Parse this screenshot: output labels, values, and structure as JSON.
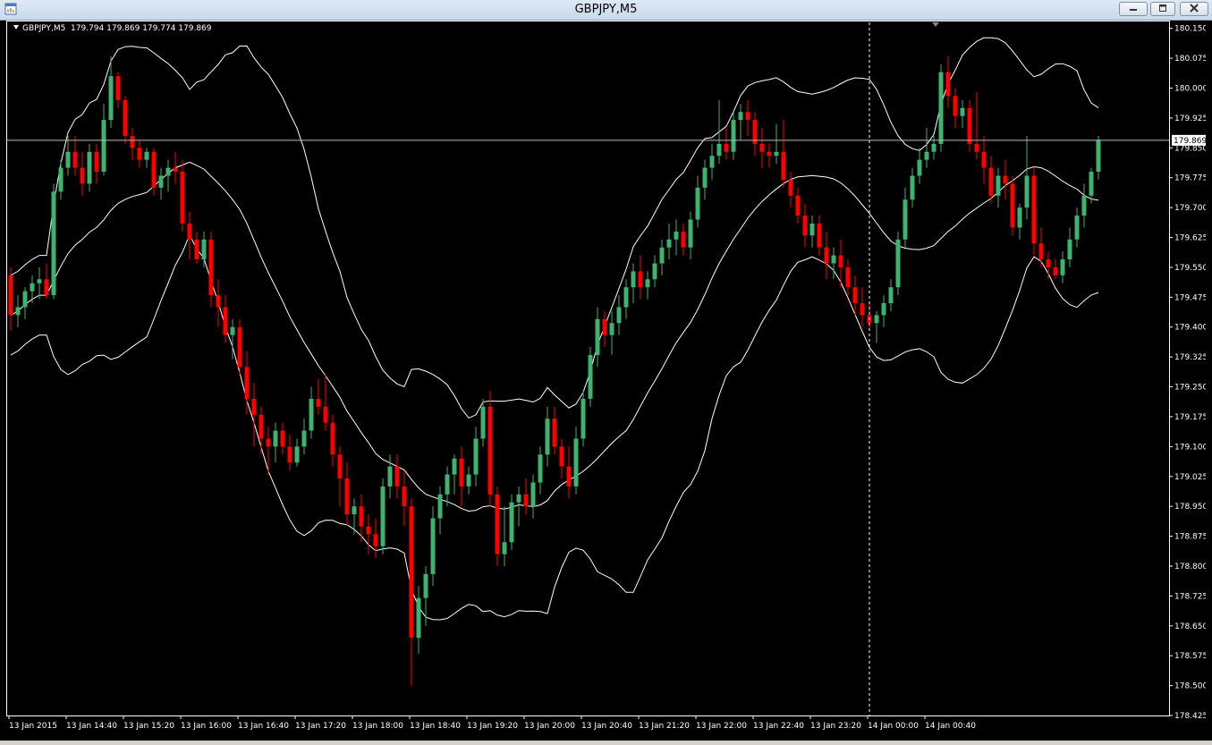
{
  "window": {
    "title": "GBPJPY,M5",
    "app_icon": "chart-window-icon",
    "buttons": {
      "minimize": "minimize-icon",
      "maximize": "maximize-icon",
      "close": "close-icon"
    }
  },
  "chart_header": {
    "symbol_tf": "GBPJPY,M5",
    "ohlc": "179.794 179.869 179.774 179.869"
  },
  "colors": {
    "bull": "#3cb371",
    "bear": "#ff0000",
    "bands": "#ffffff",
    "background": "#000000",
    "axis": "#ffffff"
  },
  "chart_data": {
    "type": "candlestick",
    "symbol": "GBPJPY",
    "timeframe": "M5",
    "indicator": "Bollinger Bands",
    "ylim": [
      178.425,
      180.165
    ],
    "y_ticks": [
      "180.150",
      "180.075",
      "180.000",
      "179.925",
      "179.850",
      "179.775",
      "179.700",
      "179.625",
      "179.550",
      "179.475",
      "179.400",
      "179.325",
      "179.250",
      "179.175",
      "179.100",
      "179.025",
      "178.950",
      "178.875",
      "178.800",
      "178.725",
      "178.650",
      "178.575",
      "178.500",
      "178.425"
    ],
    "x_ticks": [
      "13 Jan 2015",
      "13 Jan 14:40",
      "13 Jan 15:20",
      "13 Jan 16:00",
      "13 Jan 16:40",
      "13 Jan 17:20",
      "13 Jan 18:00",
      "13 Jan 18:40",
      "13 Jan 19:20",
      "13 Jan 20:00",
      "13 Jan 20:40",
      "13 Jan 21:20",
      "13 Jan 22:00",
      "13 Jan 22:40",
      "13 Jan 23:20",
      "14 Jan 00:00",
      "14 Jan 00:40"
    ],
    "current_price": "179.869",
    "candles": [
      [
        179.53,
        179.55,
        179.39,
        179.43
      ],
      [
        179.43,
        179.48,
        179.4,
        179.45
      ],
      [
        179.45,
        179.5,
        179.42,
        179.49
      ],
      [
        179.49,
        179.53,
        179.46,
        179.51
      ],
      [
        179.51,
        179.55,
        179.47,
        179.52
      ],
      [
        179.52,
        179.56,
        179.47,
        179.48
      ],
      [
        179.48,
        179.76,
        179.47,
        179.74
      ],
      [
        179.74,
        179.82,
        179.72,
        179.8
      ],
      [
        179.8,
        179.88,
        179.78,
        179.84
      ],
      [
        179.84,
        179.88,
        179.78,
        179.8
      ],
      [
        179.8,
        179.84,
        179.73,
        179.76
      ],
      [
        179.76,
        179.86,
        179.74,
        179.84
      ],
      [
        179.84,
        179.86,
        179.76,
        179.79
      ],
      [
        179.79,
        179.96,
        179.78,
        179.92
      ],
      [
        179.92,
        180.08,
        179.9,
        180.03
      ],
      [
        180.03,
        180.04,
        179.95,
        179.97
      ],
      [
        179.97,
        179.98,
        179.86,
        179.88
      ],
      [
        179.88,
        179.9,
        179.82,
        179.85
      ],
      [
        179.85,
        179.87,
        179.8,
        179.82
      ],
      [
        179.82,
        179.85,
        179.8,
        179.84
      ],
      [
        179.84,
        179.85,
        179.73,
        179.75
      ],
      [
        179.75,
        179.8,
        179.72,
        179.78
      ],
      [
        179.78,
        179.82,
        179.74,
        179.8
      ],
      [
        179.8,
        179.84,
        179.76,
        179.79
      ],
      [
        179.79,
        179.82,
        179.64,
        179.66
      ],
      [
        179.66,
        179.69,
        179.57,
        179.62
      ],
      [
        179.62,
        179.64,
        179.56,
        179.57
      ],
      [
        179.57,
        179.64,
        179.55,
        179.62
      ],
      [
        179.62,
        179.64,
        179.45,
        179.48
      ],
      [
        179.48,
        179.52,
        179.4,
        179.45
      ],
      [
        179.45,
        179.48,
        179.36,
        179.38
      ],
      [
        179.38,
        179.42,
        179.32,
        179.4
      ],
      [
        179.4,
        179.42,
        179.28,
        179.3
      ],
      [
        179.3,
        179.34,
        179.18,
        179.22
      ],
      [
        179.22,
        179.26,
        179.1,
        179.18
      ],
      [
        179.18,
        179.2,
        179.08,
        179.12
      ],
      [
        179.12,
        179.15,
        179.03,
        179.1
      ],
      [
        179.1,
        179.16,
        179.06,
        179.14
      ],
      [
        179.14,
        179.16,
        179.08,
        179.1
      ],
      [
        179.1,
        179.13,
        179.04,
        179.06
      ],
      [
        179.06,
        179.12,
        179.05,
        179.1
      ],
      [
        179.1,
        179.17,
        179.08,
        179.14
      ],
      [
        179.14,
        179.25,
        179.12,
        179.22
      ],
      [
        179.22,
        179.27,
        179.18,
        179.2
      ],
      [
        179.2,
        179.28,
        179.14,
        179.16
      ],
      [
        179.16,
        179.18,
        179.05,
        179.08
      ],
      [
        179.08,
        179.1,
        178.95,
        179.02
      ],
      [
        179.02,
        179.06,
        178.9,
        178.93
      ],
      [
        178.93,
        178.97,
        178.88,
        178.95
      ],
      [
        178.95,
        178.98,
        178.86,
        178.9
      ],
      [
        178.9,
        178.93,
        178.83,
        178.88
      ],
      [
        178.88,
        178.92,
        178.82,
        178.85
      ],
      [
        178.85,
        179.02,
        178.83,
        179.0
      ],
      [
        179.0,
        179.08,
        178.97,
        179.05
      ],
      [
        179.05,
        179.08,
        178.97,
        179.0
      ],
      [
        179.0,
        179.04,
        178.9,
        178.95
      ],
      [
        178.95,
        178.97,
        178.5,
        178.62
      ],
      [
        178.62,
        178.75,
        178.58,
        178.72
      ],
      [
        178.72,
        178.8,
        178.65,
        178.78
      ],
      [
        178.78,
        178.95,
        178.75,
        178.92
      ],
      [
        178.92,
        179.0,
        178.88,
        178.98
      ],
      [
        178.98,
        179.05,
        178.95,
        179.03
      ],
      [
        179.03,
        179.08,
        178.98,
        179.07
      ],
      [
        179.07,
        179.1,
        178.95,
        179.0
      ],
      [
        179.0,
        179.05,
        178.98,
        179.03
      ],
      [
        179.03,
        179.15,
        179.0,
        179.12
      ],
      [
        179.12,
        179.22,
        179.1,
        179.2
      ],
      [
        179.2,
        179.24,
        178.95,
        178.98
      ],
      [
        178.98,
        179.0,
        178.8,
        178.83
      ],
      [
        178.83,
        178.95,
        178.8,
        178.86
      ],
      [
        178.86,
        178.98,
        178.84,
        178.96
      ],
      [
        178.96,
        179.0,
        178.9,
        178.98
      ],
      [
        178.98,
        179.02,
        178.93,
        178.95
      ],
      [
        178.95,
        179.03,
        178.92,
        179.01
      ],
      [
        179.01,
        179.1,
        178.98,
        179.08
      ],
      [
        179.08,
        179.2,
        179.05,
        179.17
      ],
      [
        179.17,
        179.2,
        179.08,
        179.1
      ],
      [
        179.1,
        179.12,
        179.02,
        179.05
      ],
      [
        179.05,
        179.1,
        178.97,
        179.0
      ],
      [
        179.0,
        179.15,
        178.98,
        179.12
      ],
      [
        179.12,
        179.24,
        179.1,
        179.22
      ],
      [
        179.22,
        179.35,
        179.2,
        179.33
      ],
      [
        179.33,
        179.45,
        179.3,
        179.42
      ],
      [
        179.42,
        179.44,
        179.35,
        179.38
      ],
      [
        179.38,
        179.44,
        179.33,
        179.41
      ],
      [
        179.41,
        179.48,
        179.38,
        179.45
      ],
      [
        179.45,
        179.52,
        179.42,
        179.5
      ],
      [
        179.5,
        179.56,
        179.46,
        179.54
      ],
      [
        179.54,
        179.58,
        179.47,
        179.5
      ],
      [
        179.5,
        179.54,
        179.47,
        179.52
      ],
      [
        179.52,
        179.58,
        179.5,
        179.56
      ],
      [
        179.56,
        179.62,
        179.53,
        179.6
      ],
      [
        179.6,
        179.66,
        179.57,
        179.62
      ],
      [
        179.62,
        179.67,
        179.58,
        179.64
      ],
      [
        179.64,
        179.66,
        179.58,
        179.6
      ],
      [
        179.6,
        179.69,
        179.57,
        179.67
      ],
      [
        179.67,
        179.78,
        179.65,
        179.75
      ],
      [
        179.75,
        179.82,
        179.72,
        179.8
      ],
      [
        179.8,
        179.86,
        179.77,
        179.83
      ],
      [
        179.83,
        179.97,
        179.81,
        179.86
      ],
      [
        179.86,
        179.9,
        179.82,
        179.84
      ],
      [
        179.84,
        179.94,
        179.82,
        179.92
      ],
      [
        179.92,
        179.96,
        179.87,
        179.94
      ],
      [
        179.94,
        179.97,
        179.88,
        179.92
      ],
      [
        179.92,
        179.94,
        179.83,
        179.86
      ],
      [
        179.86,
        179.9,
        179.8,
        179.84
      ],
      [
        179.84,
        179.86,
        179.8,
        179.83
      ],
      [
        179.83,
        179.91,
        179.81,
        179.84
      ],
      [
        179.84,
        179.92,
        179.75,
        179.77
      ],
      [
        179.77,
        179.79,
        179.7,
        179.73
      ],
      [
        179.73,
        179.75,
        179.66,
        179.68
      ],
      [
        179.68,
        179.71,
        179.6,
        179.63
      ],
      [
        179.63,
        179.68,
        179.6,
        179.66
      ],
      [
        179.66,
        179.68,
        179.58,
        179.6
      ],
      [
        179.6,
        179.64,
        179.52,
        179.56
      ],
      [
        179.56,
        179.6,
        179.52,
        179.58
      ],
      [
        179.58,
        179.62,
        179.5,
        179.55
      ],
      [
        179.55,
        179.57,
        179.48,
        179.5
      ],
      [
        179.5,
        179.53,
        179.43,
        179.46
      ],
      [
        179.46,
        179.5,
        179.4,
        179.43
      ],
      [
        179.43,
        179.46,
        179.39,
        179.41
      ],
      [
        179.41,
        179.44,
        179.36,
        179.43
      ],
      [
        179.43,
        179.48,
        179.4,
        179.46
      ],
      [
        179.46,
        179.52,
        179.44,
        179.5
      ],
      [
        179.5,
        179.64,
        179.48,
        179.62
      ],
      [
        179.62,
        179.75,
        179.6,
        179.72
      ],
      [
        179.72,
        179.8,
        179.7,
        179.78
      ],
      [
        179.78,
        179.85,
        179.76,
        179.82
      ],
      [
        179.82,
        179.9,
        179.8,
        179.84
      ],
      [
        179.84,
        179.88,
        179.82,
        179.86
      ],
      [
        179.86,
        180.06,
        179.84,
        180.04
      ],
      [
        180.04,
        180.08,
        179.95,
        179.98
      ],
      [
        179.98,
        180.0,
        179.9,
        179.93
      ],
      [
        179.93,
        179.97,
        179.9,
        179.95
      ],
      [
        179.95,
        179.97,
        179.84,
        179.86
      ],
      [
        179.86,
        179.99,
        179.82,
        179.84
      ],
      [
        179.84,
        179.88,
        179.76,
        179.8
      ],
      [
        179.8,
        179.83,
        179.71,
        179.73
      ],
      [
        179.73,
        179.8,
        179.7,
        179.78
      ],
      [
        179.78,
        179.82,
        179.72,
        179.76
      ],
      [
        179.76,
        179.78,
        179.63,
        179.65
      ],
      [
        179.65,
        179.71,
        179.62,
        179.7
      ],
      [
        179.7,
        179.88,
        179.67,
        179.78
      ],
      [
        179.78,
        179.8,
        179.58,
        179.61
      ],
      [
        179.61,
        179.65,
        179.55,
        179.57
      ],
      [
        179.57,
        179.59,
        179.52,
        179.55
      ],
      [
        179.55,
        179.57,
        179.52,
        179.53
      ],
      [
        179.53,
        179.59,
        179.51,
        179.57
      ],
      [
        179.57,
        179.65,
        179.55,
        179.62
      ],
      [
        179.62,
        179.7,
        179.6,
        179.68
      ],
      [
        179.68,
        179.76,
        179.65,
        179.73
      ],
      [
        179.73,
        179.8,
        179.71,
        179.79
      ],
      [
        179.79,
        179.88,
        179.77,
        179.87
      ]
    ]
  }
}
